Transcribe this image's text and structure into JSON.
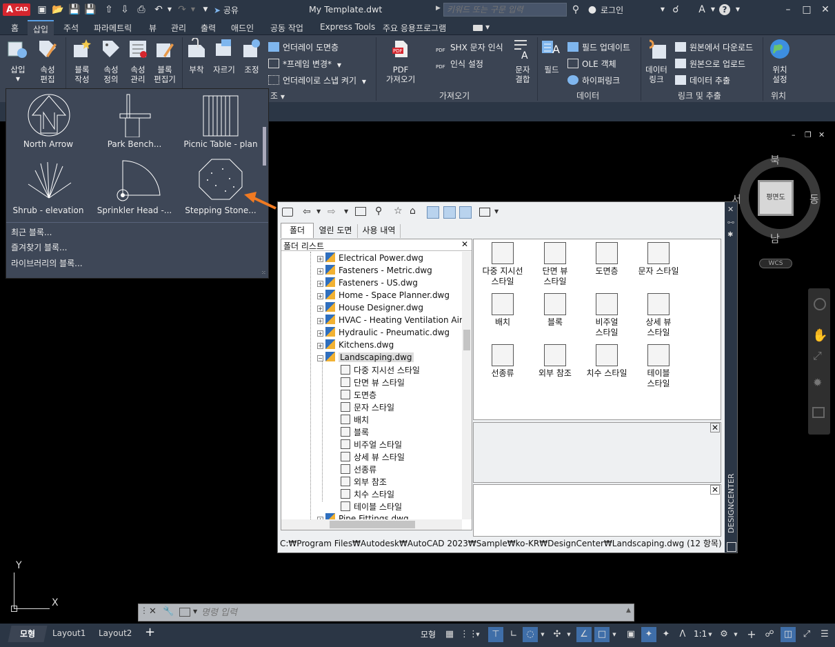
{
  "title_bar": {
    "app_badge": "CAD",
    "app_letter": "A",
    "share_label": "공유",
    "document_title": "My Template.dwt",
    "search_placeholder": "키워드 또는 구문 입력",
    "login_label": "로그인"
  },
  "menu_tabs": [
    "홈",
    "삽입",
    "주석",
    "파라메트릭",
    "뷰",
    "관리",
    "출력",
    "애드인",
    "공동 작업",
    "Express Tools",
    "주요 응용프로그램"
  ],
  "active_tab": "삽입",
  "ribbon": {
    "big_buttons": {
      "insert": "삽입",
      "attr_edit": [
        "속성",
        "편집"
      ],
      "block_create": [
        "블록",
        "작성"
      ],
      "attr_define": [
        "속성",
        "정의"
      ],
      "attr_manage": [
        "속성",
        "관리"
      ],
      "block_editor": [
        "블록",
        "편집기"
      ],
      "attach": "부착",
      "clip": "자르기",
      "adjust": "조정",
      "pdf_import": [
        "PDF",
        "가져오기"
      ],
      "text_combine": [
        "문자",
        "결합"
      ],
      "field": "필드",
      "data_link": [
        "데이터",
        "링크"
      ],
      "set_location": [
        "위치",
        "설정"
      ]
    },
    "small_buttons": {
      "underlay_layers": "언더레이 도면층",
      "frame_change": "*프레임 변경*",
      "underlay_snap": "언더레이로 스냅 켜기",
      "shx_recognize": "SHX 문자 인식",
      "recognize_settings": "인식 설정",
      "field_update": "필드 업데이트",
      "ole_object": "OLE 객체",
      "hyperlink": "하이퍼링크",
      "download_source": "원본에서 다운로드",
      "upload_source": "원본으로 업로드",
      "data_extract": "데이터 추출"
    },
    "panel_titles": {
      "reference_partial": "조",
      "import": "가져오기",
      "data": "데이터",
      "link_extract": "링크 및 추출",
      "location": "위치"
    }
  },
  "block_flyout": {
    "items": [
      "North Arrow",
      "Park Bench...",
      "Picnic Table - plan",
      "Shrub - elevation",
      "Sprinkler Head -...",
      "Stepping Stone..."
    ],
    "links": [
      "최근 블록...",
      "즐겨찾기 블록...",
      "라이브러리의 블록..."
    ]
  },
  "viewcube": {
    "north": "북",
    "south": "남",
    "east": "동",
    "west": "서",
    "face": "평면도",
    "wcs": "WCS"
  },
  "design_center": {
    "tabs": [
      "폴더",
      "열린 도면",
      "사용 내역"
    ],
    "folder_list_title": "폴더 리스트",
    "tree_files": [
      "Electrical Power.dwg",
      "Fasteners - Metric.dwg",
      "Fasteners - US.dwg",
      "Home - Space Planner.dwg",
      "House Designer.dwg",
      "HVAC - Heating Ventilation Air",
      "Hydraulic - Pneumatic.dwg",
      "Kitchens.dwg",
      "Landscaping.dwg"
    ],
    "tree_children": [
      "다중 지시선 스타일",
      "단면 뷰 스타일",
      "도면층",
      "문자 스타일",
      "배치",
      "블록",
      "비주얼 스타일",
      "상세 뷰 스타일",
      "선종류",
      "외부 참조",
      "치수 스타일",
      "테이블 스타일"
    ],
    "tree_last": "Pipe Fittings.dwg",
    "content_items": [
      [
        "다중 지시선",
        "스타일"
      ],
      [
        "단면 뷰",
        "스타일"
      ],
      [
        "도면층"
      ],
      [
        "문자 스타일"
      ],
      [
        "배치"
      ],
      [
        "블록"
      ],
      [
        "비주얼",
        "스타일"
      ],
      [
        "상세 뷰",
        "스타일"
      ],
      [
        "선종류"
      ],
      [
        "외부 참조"
      ],
      [
        "치수 스타일"
      ],
      [
        "테이블",
        "스타일"
      ]
    ],
    "status_path": "C:₩Program Files₩Autodesk₩AutoCAD 2023₩Sample₩ko-KR₩DesignCenter₩Landscaping.dwg (12 항목)",
    "side_label": "DESIGNCENTER"
  },
  "command_line": {
    "placeholder": "명령 입력"
  },
  "ucs": {
    "x": "X",
    "y": "Y"
  },
  "status_bar": {
    "layout_tabs": [
      "모형",
      "Layout1",
      "Layout2"
    ],
    "add_tab": "+",
    "model_label": "모형",
    "scale": "1:1"
  },
  "colors": {
    "accent": "#5aa0e6",
    "app_red": "#d6262e",
    "arrow_orange": "#f07a22"
  }
}
